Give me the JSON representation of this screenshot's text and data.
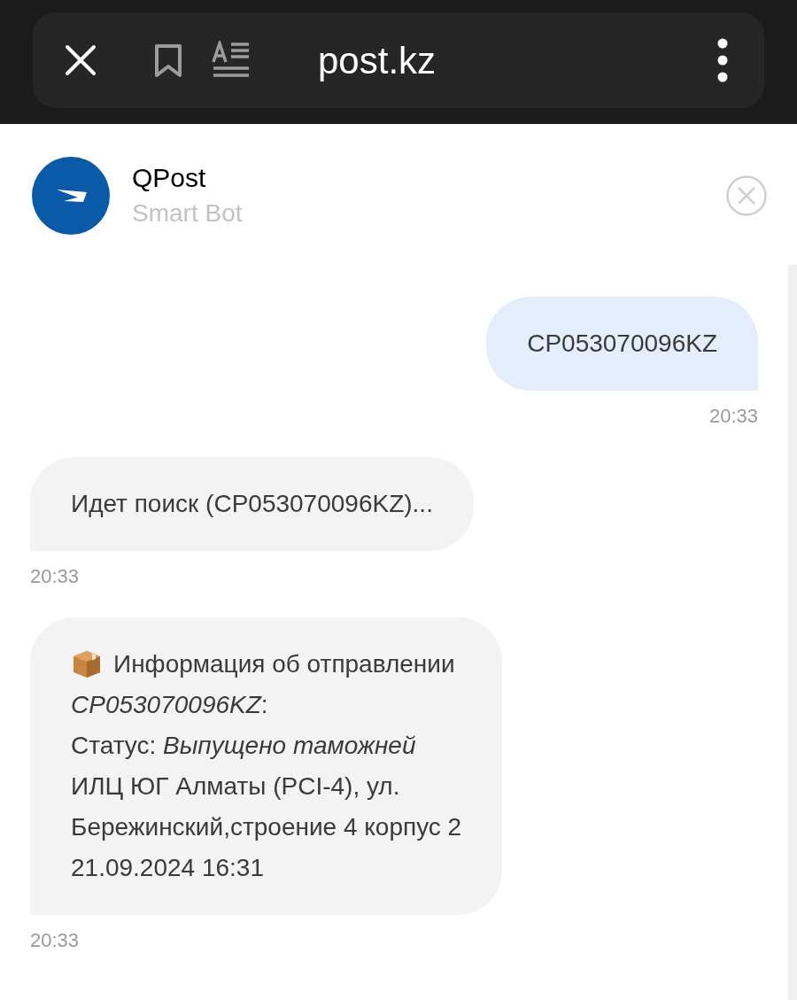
{
  "browser": {
    "url": "post.kz"
  },
  "chat_header": {
    "title": "QPost",
    "subtitle": "Smart Bot"
  },
  "messages": [
    {
      "kind": "sent",
      "lines": [
        "CP053070096KZ"
      ],
      "time": "20:33"
    },
    {
      "kind": "received",
      "lines": [
        "Идет поиск (CP053070096KZ)..."
      ],
      "time": "20:33"
    },
    {
      "kind": "parcel_info",
      "lines": [
        "Информация об отправлении",
        "*CP053070096KZ*:",
        "Статус: *Выпущено таможней*",
        "ИЛЦ ЮГ Алматы (PCI-4), ул.",
        "Бережинский,строение 4 корпус 2",
        "21.09.2024 16:31"
      ],
      "time": "20:33"
    }
  ]
}
